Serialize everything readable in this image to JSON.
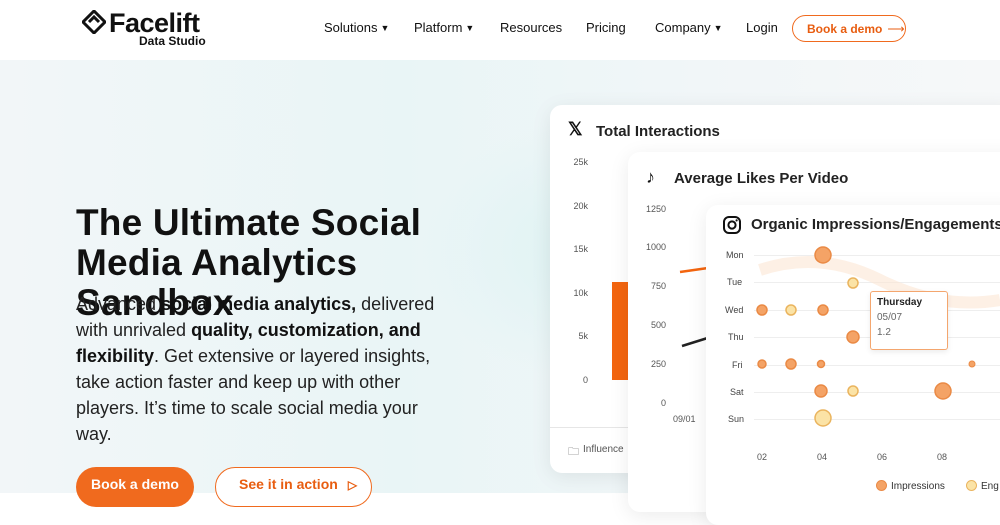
{
  "brand": {
    "name": "Facelift",
    "sub": "Data Studio"
  },
  "nav": {
    "items": [
      {
        "label": "Solutions",
        "dropdown": true
      },
      {
        "label": "Platform",
        "dropdown": true
      },
      {
        "label": "Resources",
        "dropdown": false
      },
      {
        "label": "Pricing",
        "dropdown": false
      },
      {
        "label": "Company",
        "dropdown": true
      },
      {
        "label": "Login",
        "dropdown": false
      }
    ],
    "cta": "Book a demo"
  },
  "hero": {
    "title_line1": "The Ultimate Social",
    "title_line2": "Media Analytics Sandbox",
    "p1": "Advanced ",
    "b1": "social media analytics,",
    "p2": " delivered with unrivaled ",
    "b2": "quality, customization, and flexibility",
    "p3": ". Get extensive or layered insights, take action faster and keep up with other players. It’s time to scale social media your way.",
    "primary_cta": "Book a demo",
    "secondary_cta": "See it in action"
  },
  "cards": {
    "x": {
      "title": "Total Interactions",
      "y_ticks": [
        "25k",
        "20k",
        "15k",
        "10k",
        "5k",
        "0"
      ],
      "footer_label": "Influence"
    },
    "tiktok": {
      "title": "Average Likes Per Video",
      "y_ticks": [
        "1250",
        "1000",
        "750",
        "500",
        "250",
        "0"
      ],
      "x_tick": "09/01"
    },
    "instagram": {
      "title": "Organic Impressions/Engagements O",
      "days": [
        "Mon",
        "Tue",
        "Wed",
        "Thu",
        "Fri",
        "Sat",
        "Sun"
      ],
      "x_ticks": [
        "02",
        "04",
        "06",
        "08"
      ],
      "tooltip": {
        "title": "Thursday",
        "date": "05/07",
        "value": "1.2"
      },
      "legend": [
        "Impressions",
        "Eng"
      ]
    }
  },
  "colors": {
    "accent": "#f06a1e",
    "bar": "#f3650f",
    "bubble_orange": "#f4a366",
    "bubble_yellow": "#fbe3a6"
  }
}
